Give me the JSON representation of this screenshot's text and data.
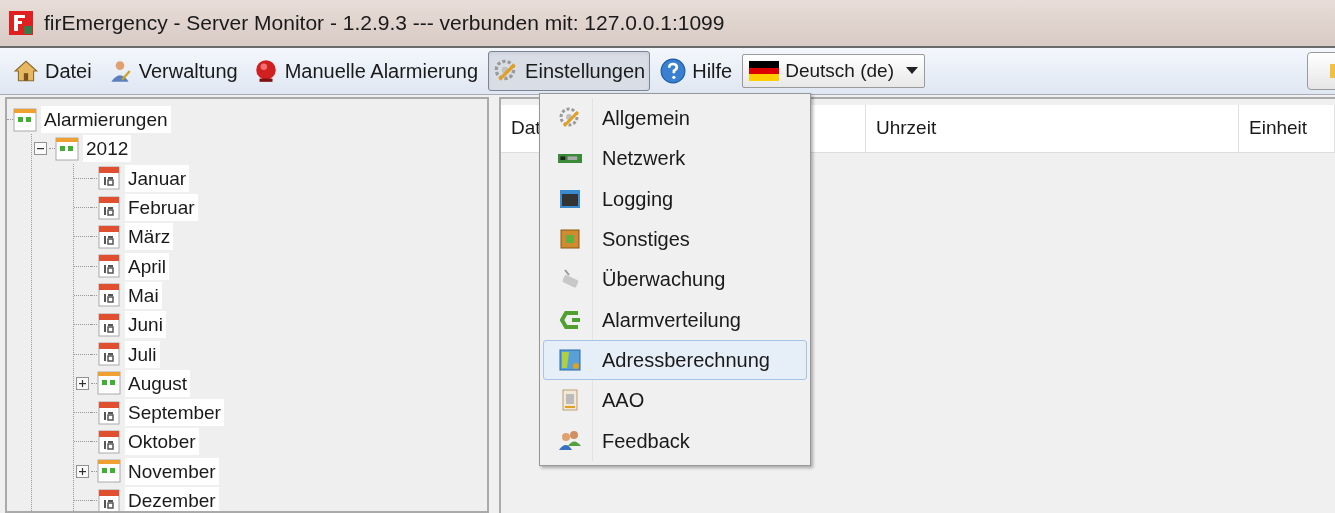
{
  "window": {
    "title": "firEmergency - Server Monitor - 1.2.9.3 --- verbunden mit: 127.0.0.1:1099"
  },
  "toolbar": {
    "items": [
      {
        "kind": "home",
        "label": "Datei",
        "selected": false
      },
      {
        "kind": "admin",
        "label": "Verwaltung",
        "selected": false
      },
      {
        "kind": "alarm",
        "label": "Manuelle Alarmierung",
        "selected": false
      },
      {
        "kind": "gear",
        "label": "Einstellungen",
        "selected": true
      },
      {
        "kind": "help",
        "label": "Hilfe",
        "selected": false
      }
    ],
    "language": {
      "value": "Deutsch (de)"
    }
  },
  "tree": {
    "label": "Alarmierungen",
    "kind": "group",
    "children": [
      {
        "label": "2012",
        "kind": "group",
        "expanded": true,
        "children": [
          {
            "label": "Januar",
            "kind": "month"
          },
          {
            "label": "Februar",
            "kind": "month"
          },
          {
            "label": "März",
            "kind": "month"
          },
          {
            "label": "April",
            "kind": "month"
          },
          {
            "label": "Mai",
            "kind": "month"
          },
          {
            "label": "Juni",
            "kind": "month"
          },
          {
            "label": "Juli",
            "kind": "month"
          },
          {
            "label": "August",
            "kind": "group",
            "expanded": false
          },
          {
            "label": "September",
            "kind": "month"
          },
          {
            "label": "Oktober",
            "kind": "month"
          },
          {
            "label": "November",
            "kind": "group",
            "expanded": false
          },
          {
            "label": "Dezember",
            "kind": "month"
          }
        ]
      }
    ]
  },
  "table": {
    "columns": [
      "Dat",
      "Uhrzeit",
      "Einheit"
    ]
  },
  "settings_menu": {
    "items": [
      {
        "kind": "gear",
        "label": "Allgemein",
        "selected": false
      },
      {
        "kind": "network",
        "label": "Netzwerk",
        "selected": false
      },
      {
        "kind": "console",
        "label": "Logging",
        "selected": false
      },
      {
        "kind": "box",
        "label": "Sonstiges",
        "selected": false
      },
      {
        "kind": "camera",
        "label": "Überwachung",
        "selected": false
      },
      {
        "kind": "arrows",
        "label": "Alarmverteilung",
        "selected": false
      },
      {
        "kind": "map",
        "label": "Adressberechnung",
        "selected": true
      },
      {
        "kind": "document",
        "label": "AAO",
        "selected": false
      },
      {
        "kind": "people",
        "label": "Feedback",
        "selected": false
      }
    ]
  }
}
